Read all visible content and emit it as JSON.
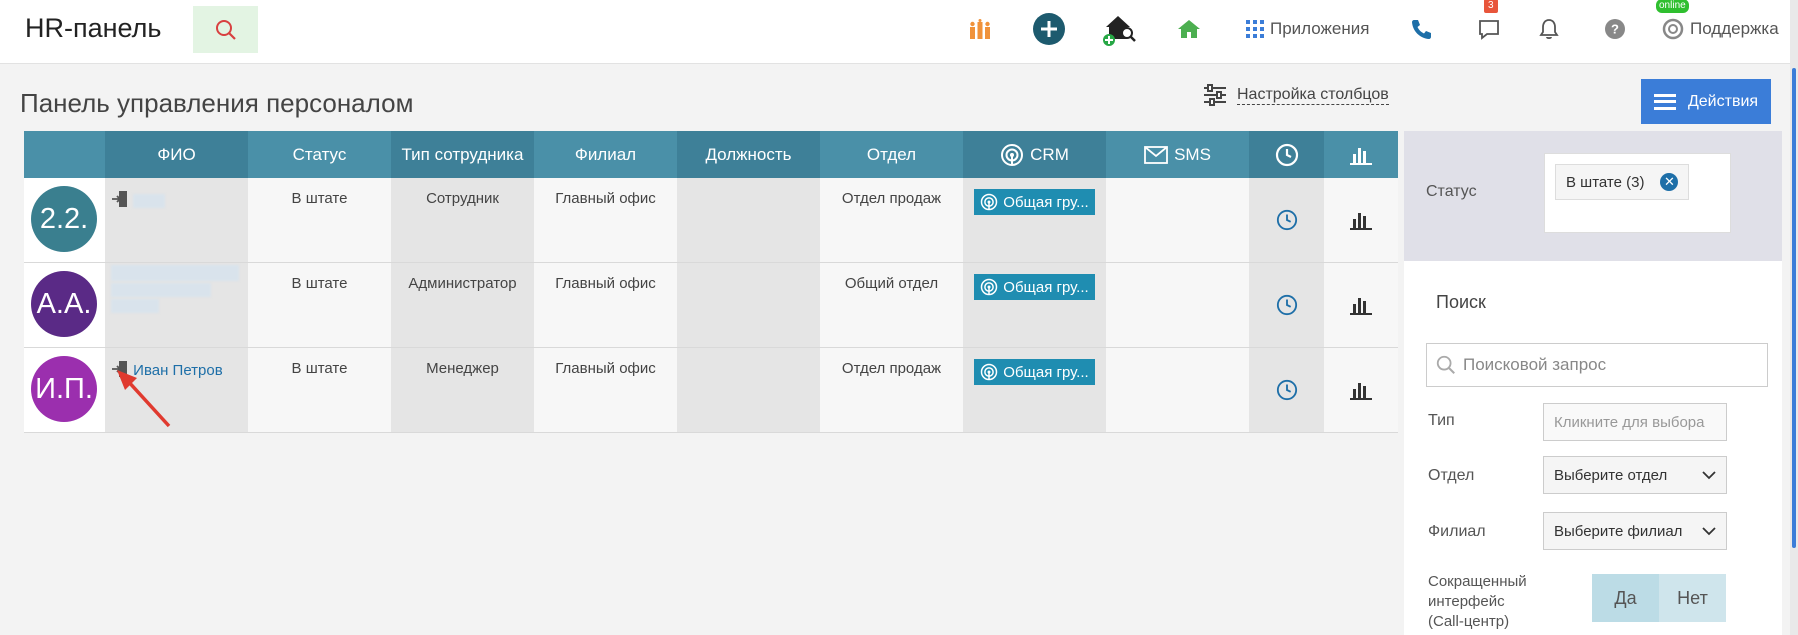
{
  "header": {
    "app_title": "HR-панель",
    "apps_label": "Приложения",
    "messages_badge": "3",
    "online_badge": "online",
    "support_label": "Поддержка"
  },
  "page": {
    "title": "Панель управления персоналом",
    "column_settings_label": "Настройка столбцов",
    "actions_label": "Действия"
  },
  "table": {
    "headers": {
      "fio": "ФИО",
      "status": "Статус",
      "type": "Тип сотрудника",
      "branch": "Филиал",
      "position": "Должность",
      "department": "Отдел",
      "crm": "CRM",
      "sms": "SMS"
    },
    "rows": [
      {
        "initials": "2.2.",
        "avatar_color": "#3a7f8f",
        "name": "",
        "status": "В штате",
        "type": "Сотрудник",
        "branch": "Главный офис",
        "position": "",
        "department": "Отдел продаж",
        "crm": "Общая гру..."
      },
      {
        "initials": "А.А.",
        "avatar_color": "#5a2a86",
        "name": "",
        "status": "В штате",
        "type": "Администратор",
        "branch": "Главный офис",
        "position": "",
        "department": "Общий отдел",
        "crm": "Общая гру..."
      },
      {
        "initials": "И.П.",
        "avatar_color": "#9b2fae",
        "name": "Иван Петров",
        "status": "В штате",
        "type": "Менеджер",
        "branch": "Главный офис",
        "position": "",
        "department": "Отдел продаж",
        "crm": "Общая гру..."
      }
    ]
  },
  "filters": {
    "status_label": "Статус",
    "status_chip": "В штате (3)",
    "search_title": "Поиск",
    "search_placeholder": "Поисковой запрос",
    "type_label": "Тип",
    "type_placeholder": "Кликните для выбора",
    "department_label": "Отдел",
    "department_value": "Выберите отдел",
    "branch_label": "Филиал",
    "branch_value": "Выберите филиал",
    "short_ui_label_1": "Сокращенный",
    "short_ui_label_2": "интерфейс",
    "short_ui_label_3": "(Call-центр)",
    "yes": "Да",
    "no": "Нет"
  },
  "colors": {
    "header_bg": "#4a90a8",
    "accent": "#3b7dd8",
    "crm_tag": "#1f8db1",
    "arrow": "#e03a2f"
  }
}
